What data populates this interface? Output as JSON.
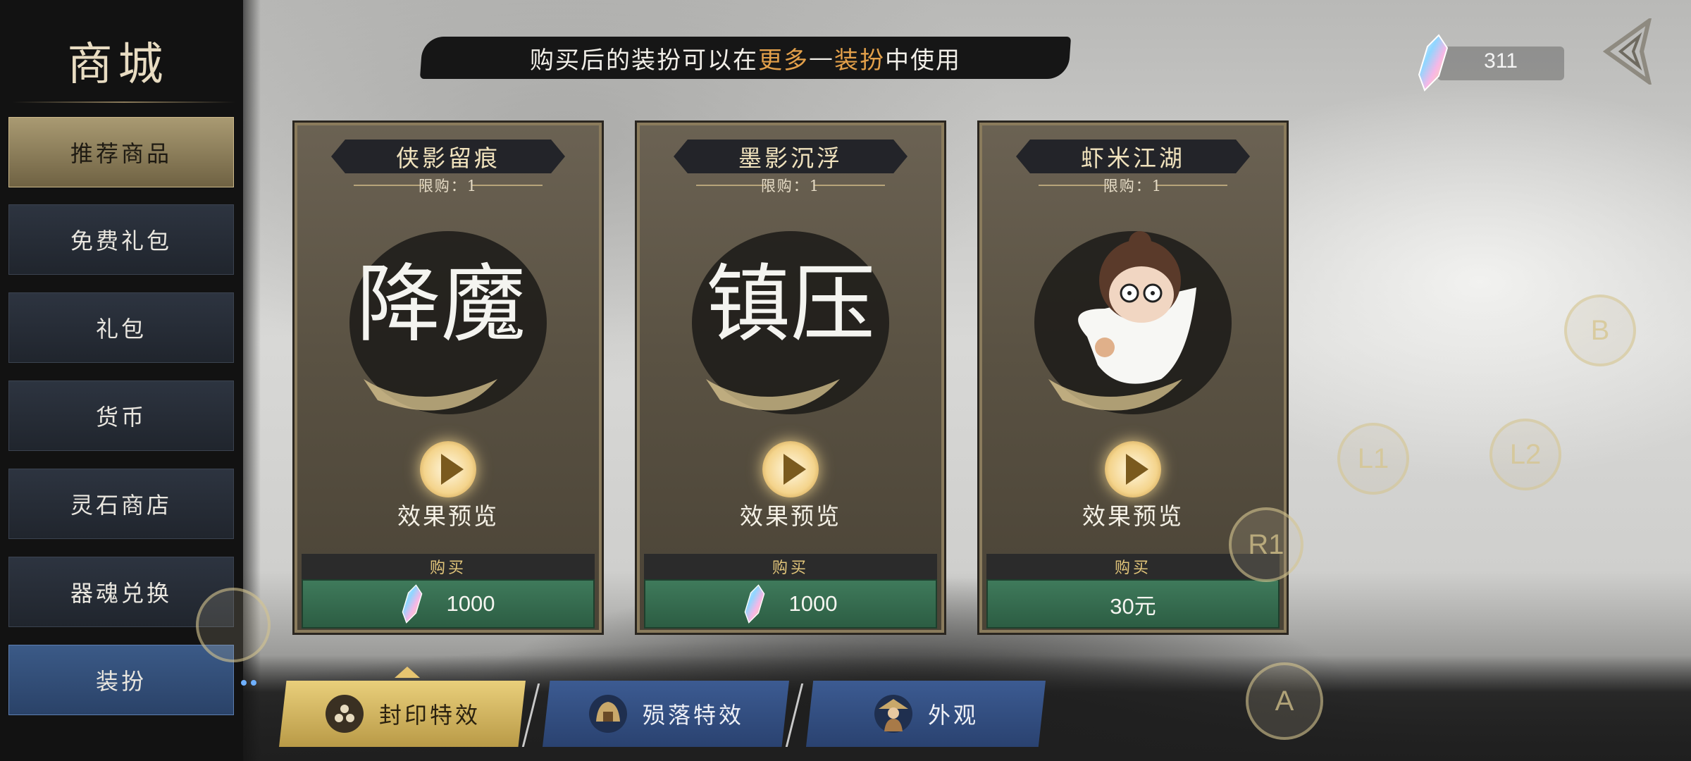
{
  "sidebar": {
    "title": "商城",
    "items": [
      {
        "label": "推荐商品",
        "state": "active"
      },
      {
        "label": "免费礼包"
      },
      {
        "label": "礼包"
      },
      {
        "label": "货币"
      },
      {
        "label": "灵石商店"
      },
      {
        "label": "器魂兑换"
      },
      {
        "label": "装扮",
        "state": "selected"
      }
    ]
  },
  "banner": {
    "prefix": "购买后的装扮可以在",
    "highlight1": "更多",
    "dash": "—",
    "highlight2": "装扮",
    "suffix": "中使用"
  },
  "currency": {
    "icon": "crystal-gem-icon",
    "value": "311"
  },
  "cards": [
    {
      "name": "侠影留痕",
      "limit": "限购：1",
      "art_text": "降魔",
      "preview_label": "效果预览",
      "buy_label": "购买",
      "price": "1000",
      "price_icon": "crystal-gem-icon"
    },
    {
      "name": "墨影沉浮",
      "limit": "限购：1",
      "art_text": "镇压",
      "preview_label": "效果预览",
      "buy_label": "购买",
      "price": "1000",
      "price_icon": "crystal-gem-icon"
    },
    {
      "name": "虾米江湖",
      "limit": "限购：1",
      "art_text": "",
      "preview_label": "效果预览",
      "buy_label": "购买",
      "price": "30元"
    }
  ],
  "tabs": [
    {
      "label": "封印特效",
      "state": "active",
      "icon": "seal-icon"
    },
    {
      "label": "殒落特效",
      "icon": "helmet-icon"
    },
    {
      "label": "外观",
      "icon": "character-icon"
    }
  ],
  "controller": {
    "buttons": [
      "B",
      "L1",
      "L2",
      "R1",
      "A"
    ]
  },
  "colors": {
    "accent_gold": "#e3a04a",
    "price_green": "#2c5d43",
    "tab_active": "#e9cf7b",
    "tab_inactive": "#3c5b92"
  }
}
